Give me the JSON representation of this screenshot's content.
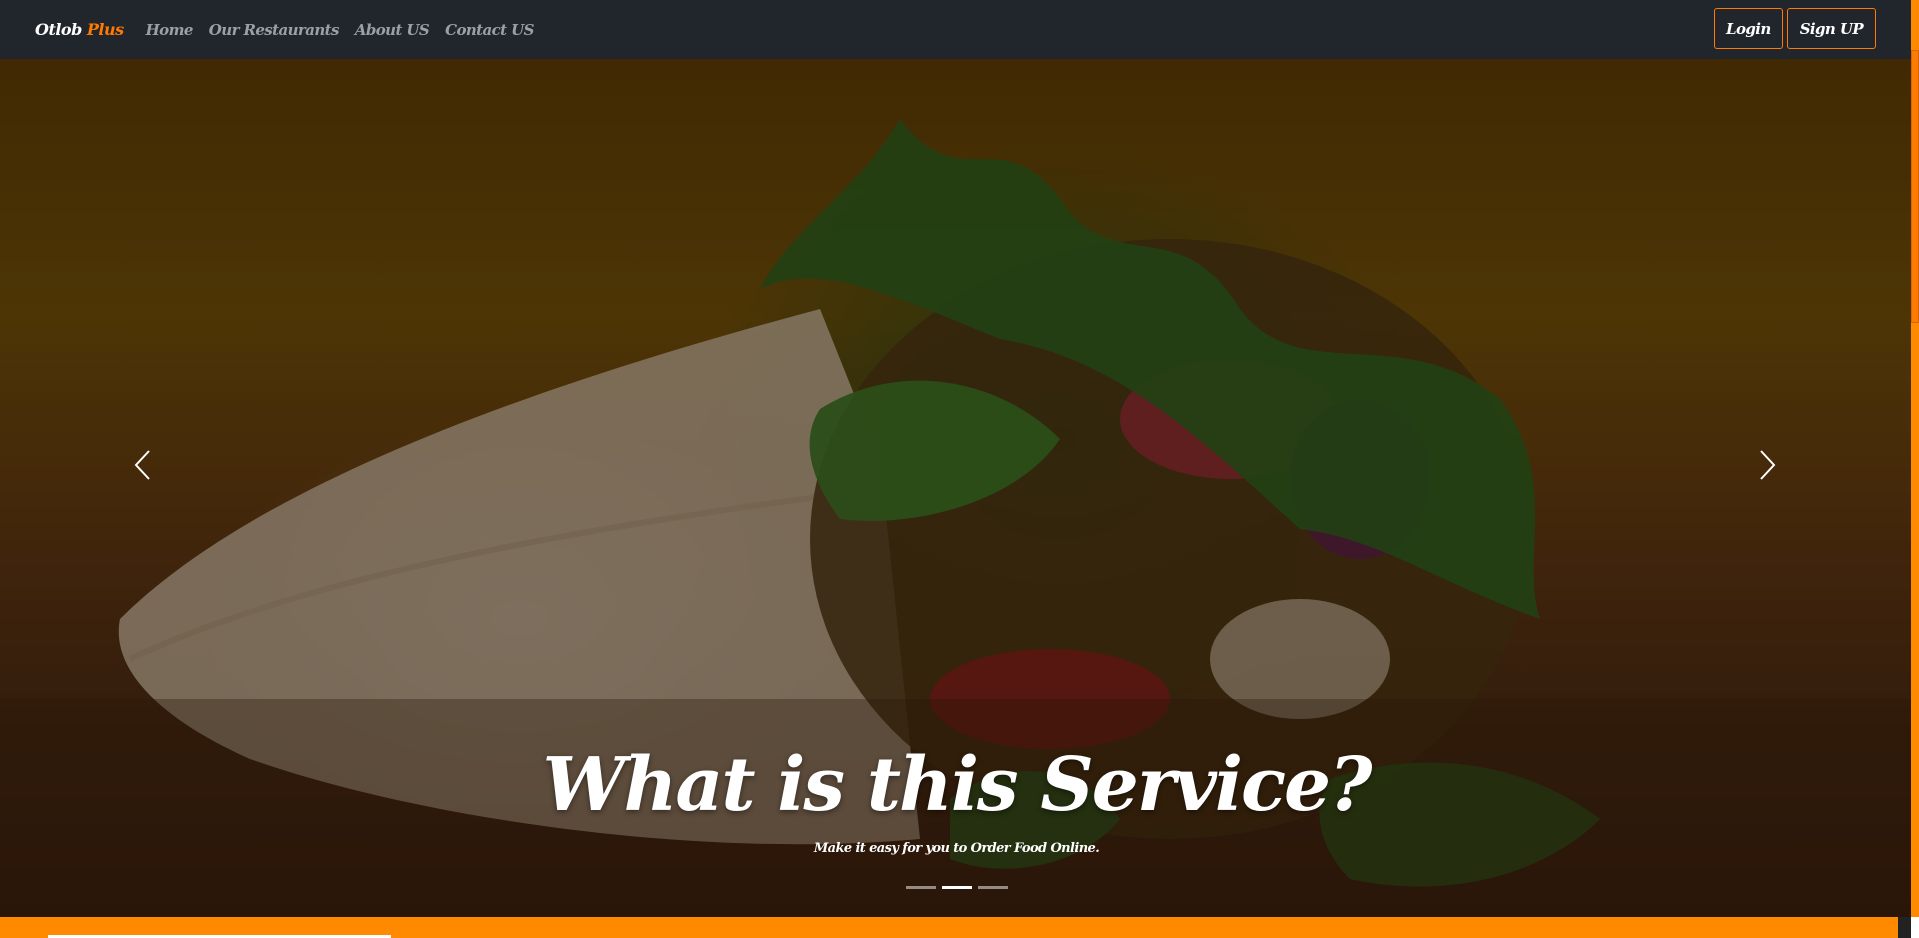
{
  "navbar": {
    "brand": {
      "name": "Otlob",
      "accent": "Plus"
    },
    "links": [
      "Home",
      "Our Restaurants",
      "About US",
      "Contact US"
    ],
    "login_label": "Login",
    "signup_label": "Sign UP"
  },
  "hero": {
    "title": "What is this Service?",
    "subtitle": "Make it easy for you to Order Food Online.",
    "slides_total": 3,
    "active_slide": 2
  },
  "colors": {
    "accent": "#ff7a00",
    "navbar_bg": "#21262d",
    "link": "#9aa0a6"
  },
  "icons": {
    "prev": "chevron-left-icon",
    "next": "chevron-right-icon"
  }
}
